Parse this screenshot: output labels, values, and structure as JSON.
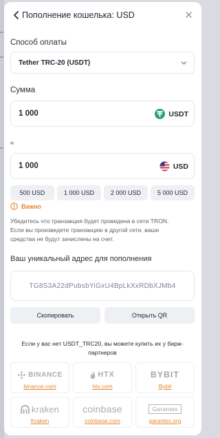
{
  "header": {
    "title": "Пополнение кошелька: USD"
  },
  "payment": {
    "label": "Способ оплаты",
    "selected": "Tether TRC-20 (USDT)"
  },
  "amount": {
    "label": "Сумма",
    "value": "1 000",
    "currency": "USDT",
    "currency_icon": "tether-icon",
    "currency_color": "#26a17b"
  },
  "converted": {
    "approx_sign": "≈",
    "value": "1 000",
    "currency": "USD",
    "currency_icon": "us-flag-icon"
  },
  "presets": [
    "500 USD",
    "1 000 USD",
    "2 000 USD",
    "5 000 USD"
  ],
  "warning": {
    "title": "Важно",
    "lines": [
      "Убедитесь что транзакция будет проведена в сети TRON.",
      "Если вы произведете транзакцию в другой сети, ваши",
      "средства не будут зачислены на счет."
    ],
    "accent_color": "#e5862d"
  },
  "address": {
    "label": "Ваш уникальный адрес для пополнения",
    "value": "TG8S3A22dPubsbYiGxU4BpLkXxRDbXJMb4"
  },
  "actions": {
    "copy": "Скопировать",
    "qr": "Открыть QR"
  },
  "partners": {
    "lines": [
      "Если у вас нет USDT_TRC20, вы можете купить их у бирж-",
      "партнеров"
    ],
    "items": [
      {
        "logo_text": "BINANCE",
        "icon": "binance-diamond-icon",
        "link": "binance.com"
      },
      {
        "logo_text": "HTX",
        "icon": "htx-flame-icon",
        "link": "htx.com"
      },
      {
        "logo_text": "BYBIT",
        "icon": "",
        "link": "Bybit"
      },
      {
        "logo_text": "kraken",
        "icon": "kraken-icon",
        "link": "Kraken"
      },
      {
        "logo_text": "coinbase",
        "icon": "",
        "link": "coinbase.com"
      },
      {
        "logo_text": "Garantex",
        "icon": "garantex-icon",
        "link": "garantex.org"
      }
    ]
  }
}
